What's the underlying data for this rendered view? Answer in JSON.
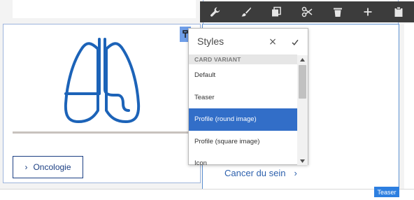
{
  "toolbar": {
    "icons": [
      "wrench-icon",
      "paintbrush-icon",
      "copy-icon",
      "cut-icon",
      "delete-icon",
      "add-icon",
      "paste-icon"
    ]
  },
  "styles_popover": {
    "title": "Styles",
    "close_symbol": "×",
    "group_header": "CARD VARIANT",
    "options": [
      {
        "label": "Default",
        "selected": false
      },
      {
        "label": "Teaser",
        "selected": false
      },
      {
        "label": "Profile (round image)",
        "selected": true
      },
      {
        "label": "Profile (square image)",
        "selected": false
      },
      {
        "label": "Icon",
        "selected": false
      }
    ]
  },
  "left_card": {
    "icon": "lungs-icon",
    "button_label": "Oncologie",
    "button_chevron": "›"
  },
  "middle_card": {
    "link_label": "Cancer du sein",
    "link_chevron": "›",
    "component_tag": "Teaser"
  },
  "colors": {
    "brand_blue": "#1c63b8",
    "button_navy": "#1c3f83",
    "selection_blue": "#326ec8",
    "toolbar_dark": "#3c3c3c",
    "tag_blue": "#2d7fe0"
  }
}
